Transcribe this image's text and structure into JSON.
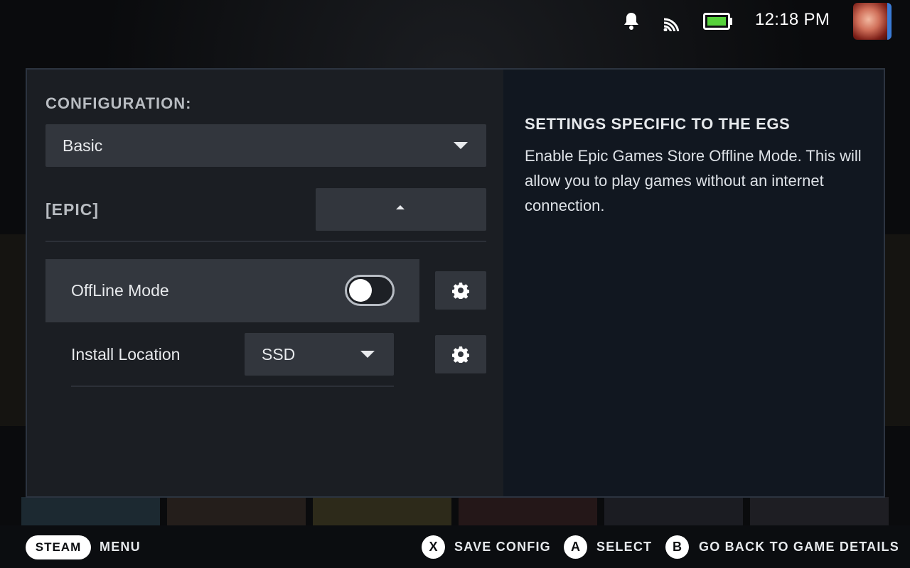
{
  "status": {
    "time": "12:18 PM",
    "battery_color": "#56d13b"
  },
  "config": {
    "label": "CONFIGURATION:",
    "selected": "Basic"
  },
  "section": {
    "label": "[EPIC]"
  },
  "settings": [
    {
      "label": "OffLine Mode",
      "type": "toggle",
      "enabled": false
    },
    {
      "label": "Install Location",
      "type": "select",
      "value": "SSD"
    }
  ],
  "help": {
    "title": "SETTINGS SPECIFIC TO THE EGS",
    "body": "Enable Epic Games Store Offline Mode. This will allow you to play games without an internet connection."
  },
  "footer": {
    "steam": "STEAM",
    "menu": "MENU",
    "x_key": "X",
    "x_label": "SAVE CONFIG",
    "a_key": "A",
    "a_label": "SELECT",
    "b_key": "B",
    "b_label": "GO BACK TO GAME DETAILS"
  }
}
